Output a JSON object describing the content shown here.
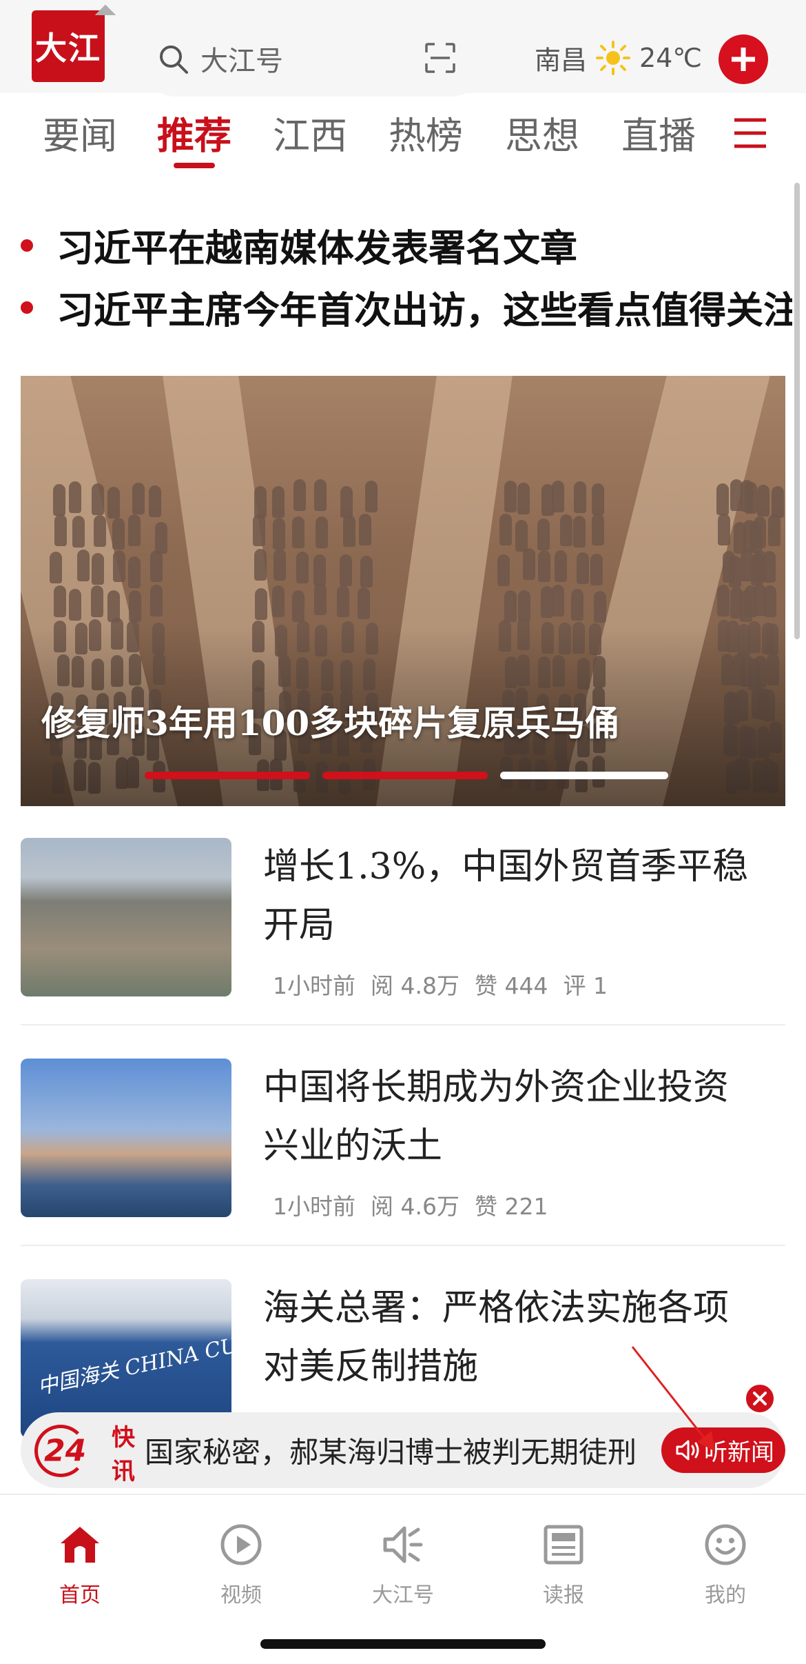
{
  "topbar": {
    "logo_text": "大江",
    "search_placeholder": "大江号",
    "city": "南昌",
    "temperature": "24℃",
    "icons": [
      "search-icon",
      "scan-icon",
      "sun-icon",
      "plus-icon"
    ]
  },
  "tabs": [
    {
      "label": "要闻",
      "active": false
    },
    {
      "label": "推荐",
      "active": true
    },
    {
      "label": "江西",
      "active": false
    },
    {
      "label": "热榜",
      "active": false
    },
    {
      "label": "思想",
      "active": false
    },
    {
      "label": "直播",
      "active": false
    }
  ],
  "headlines": [
    "习近平在越南媒体发表署名文章",
    "习近平主席今年首次出访，这些看点值得关注"
  ],
  "hero": {
    "caption": "修复师3年用100多块碎片复原兵马俑",
    "slides_total": 3,
    "slide_active": 3
  },
  "news": [
    {
      "title": "增长1.3%，中国外贸首季平稳开局",
      "time": "1小时前",
      "reads": "阅 4.8万",
      "likes": "赞 444",
      "comments": "评 1"
    },
    {
      "title": "中国将长期成为外资企业投资兴业的沃土",
      "time": "1小时前",
      "reads": "阅 4.6万",
      "likes": "赞 221",
      "comments": ""
    },
    {
      "title": "海关总署：严格依法实施各项对美反制措施",
      "thumb_text": "中国海关 CHINA CUSTOMS"
    }
  ],
  "flash": {
    "logo_num": "24",
    "logo_label": "快讯",
    "ticker": "国家秘密，郝某海归博士被判无期徒刑",
    "listen_label": "听新闻"
  },
  "bottom_nav": [
    {
      "label": "首页",
      "icon": "home-icon",
      "active": true
    },
    {
      "label": "视频",
      "icon": "play-icon",
      "active": false
    },
    {
      "label": "大江号",
      "icon": "megaphone-icon",
      "active": false
    },
    {
      "label": "读报",
      "icon": "newspaper-icon",
      "active": false
    },
    {
      "label": "我的",
      "icon": "smiley-icon",
      "active": false
    }
  ],
  "colors": {
    "brand_red": "#c8101b",
    "tab_inactive": "#666666",
    "meta_gray": "#888888"
  }
}
